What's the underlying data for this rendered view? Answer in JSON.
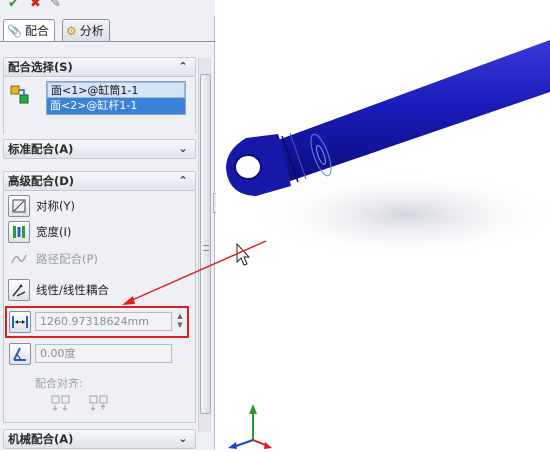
{
  "tabs": {
    "mate": "配合",
    "analysis": "分析"
  },
  "sections": {
    "mate_selection": {
      "title": "配合选择(S)",
      "items": [
        "面<1>@缸筒1-1",
        "面<2>@缸杆1-1"
      ]
    },
    "standard": {
      "title": "标准配合(A)"
    },
    "advanced": {
      "title": "高级配合(D)",
      "symmetric": "对称(Y)",
      "width": "宽度(I)",
      "path": "路径配合(P)",
      "linear_coupler": "线性/线性耦合",
      "distance_value": "1260.97318624mm",
      "angle_value": "0.00度",
      "alignment_label": "配合对齐:"
    },
    "mechanical": {
      "title": "机械配合(A)"
    }
  },
  "colors": {
    "accent_red": "#e02020",
    "part_blue": "#1520b0",
    "selection_blue": "#3a82d6"
  }
}
